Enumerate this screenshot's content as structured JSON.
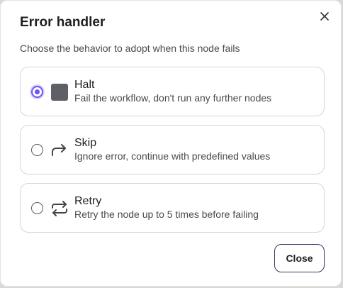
{
  "dialog": {
    "title": "Error handler",
    "subtitle": "Choose the behavior to adopt when this node fails",
    "close_button": "Close"
  },
  "options": [
    {
      "label": "Halt",
      "description": "Fail the workflow, don't run any further nodes",
      "icon": "stop-square-icon",
      "selected": true
    },
    {
      "label": "Skip",
      "description": "Ignore error, continue with predefined values",
      "icon": "skip-arrow-icon",
      "selected": false
    },
    {
      "label": "Retry",
      "description": "Retry the node up to 5 times before failing",
      "icon": "retry-icon",
      "selected": false
    }
  ],
  "colors": {
    "accent": "#6a56f2",
    "button_border": "#3d3566",
    "card_border": "#d6d6d6"
  }
}
